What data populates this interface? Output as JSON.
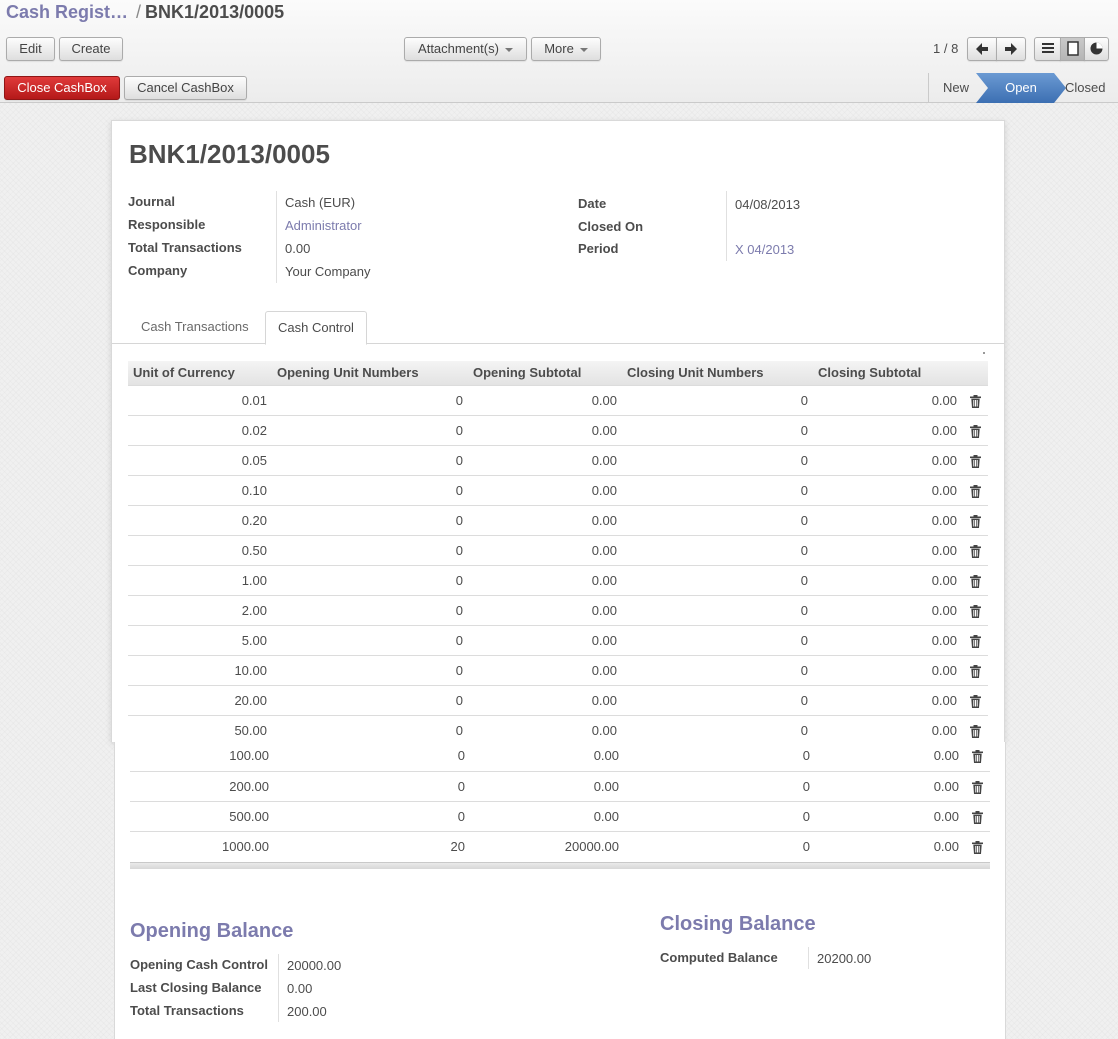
{
  "breadcrumb": {
    "parent": "Cash Regist…",
    "separator": "/",
    "current": "BNK1/2013/0005"
  },
  "toolbar": {
    "edit": "Edit",
    "create": "Create",
    "attachments": "Attachment(s)",
    "more": "More",
    "pager": "1 / 8",
    "icons": {
      "prev": "arrow-left-icon",
      "next": "arrow-right-icon",
      "list": "list-view-icon",
      "form": "form-view-icon",
      "other": "graph-view-icon"
    }
  },
  "actions": {
    "close_cashbox": "Close CashBox",
    "cancel_cashbox": "Cancel CashBox"
  },
  "statusbar": {
    "new": "New",
    "open": "Open",
    "closed": "Closed",
    "active": "Open"
  },
  "record": {
    "title": "BNK1/2013/0005",
    "left": [
      {
        "label": "Journal",
        "value": "Cash (EUR)",
        "link": false
      },
      {
        "label": "Responsible",
        "value": "Administrator",
        "link": true
      },
      {
        "label": "Total Transactions",
        "value": "0.00",
        "link": false
      },
      {
        "label": "Company",
        "value": "Your Company",
        "link": false
      }
    ],
    "right": [
      {
        "label": "Date",
        "value": "04/08/2013",
        "link": false
      },
      {
        "label": "Closed On",
        "value": "",
        "link": false
      },
      {
        "label": "Period",
        "value": "X 04/2013",
        "link": true
      }
    ]
  },
  "tabs": [
    {
      "label": "Cash Transactions",
      "active": false
    },
    {
      "label": "Cash Control",
      "active": true
    }
  ],
  "cash_table": {
    "headers": [
      "Unit of Currency",
      "Opening Unit Numbers",
      "Opening Subtotal",
      "Closing Unit Numbers",
      "Closing Subtotal"
    ],
    "rows": [
      [
        "0.01",
        "0",
        "0.00",
        "0",
        "0.00"
      ],
      [
        "0.02",
        "0",
        "0.00",
        "0",
        "0.00"
      ],
      [
        "0.05",
        "0",
        "0.00",
        "0",
        "0.00"
      ],
      [
        "0.10",
        "0",
        "0.00",
        "0",
        "0.00"
      ],
      [
        "0.20",
        "0",
        "0.00",
        "0",
        "0.00"
      ],
      [
        "0.50",
        "0",
        "0.00",
        "0",
        "0.00"
      ],
      [
        "1.00",
        "0",
        "0.00",
        "0",
        "0.00"
      ],
      [
        "2.00",
        "0",
        "0.00",
        "0",
        "0.00"
      ],
      [
        "5.00",
        "0",
        "0.00",
        "0",
        "0.00"
      ],
      [
        "10.00",
        "0",
        "0.00",
        "0",
        "0.00"
      ],
      [
        "20.00",
        "0",
        "0.00",
        "0",
        "0.00"
      ],
      [
        "50.00",
        "0",
        "0.00",
        "0",
        "0.00"
      ],
      [
        "100.00",
        "0",
        "0.00",
        "0",
        "0.00"
      ],
      [
        "200.00",
        "0",
        "0.00",
        "0",
        "0.00"
      ],
      [
        "500.00",
        "0",
        "0.00",
        "0",
        "0.00"
      ],
      [
        "1000.00",
        "20",
        "20000.00",
        "0",
        "0.00"
      ]
    ],
    "row_icon": "trash-icon"
  },
  "opening_balance": {
    "title": "Opening Balance",
    "fields": [
      {
        "label": "Opening Cash Control",
        "value": "20000.00"
      },
      {
        "label": "Last Closing Balance",
        "value": "0.00"
      },
      {
        "label": "Total Transactions",
        "value": "200.00"
      }
    ]
  },
  "closing_balance": {
    "title": "Closing Balance",
    "fields": [
      {
        "label": "Computed Balance",
        "value": "20200.00"
      }
    ]
  },
  "colors": {
    "link": "#7c7bad",
    "primary_red": "#c62121",
    "status_active": "#4a7dbf"
  }
}
